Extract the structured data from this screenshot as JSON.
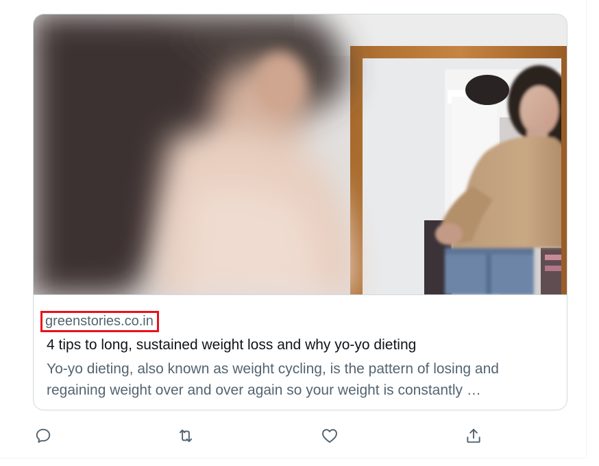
{
  "card": {
    "domain": "greenstories.co.in",
    "title": "4 tips to long, sustained weight loss and why yo-yo dieting",
    "description": "Yo-yo dieting, also known as weight cycling, is the pattern of losing and regaining weight over and over again so your weight is constantly …",
    "image_icon": "woman-looking-in-mirror-photo",
    "highlight_color": "#e8101a"
  },
  "actions": [
    {
      "icon": "reply-icon"
    },
    {
      "icon": "retweet-icon"
    },
    {
      "icon": "like-icon"
    },
    {
      "icon": "share-icon"
    }
  ],
  "colors": {
    "text_primary": "#0f1419",
    "text_secondary": "#536471",
    "border": "#cfd9de"
  }
}
